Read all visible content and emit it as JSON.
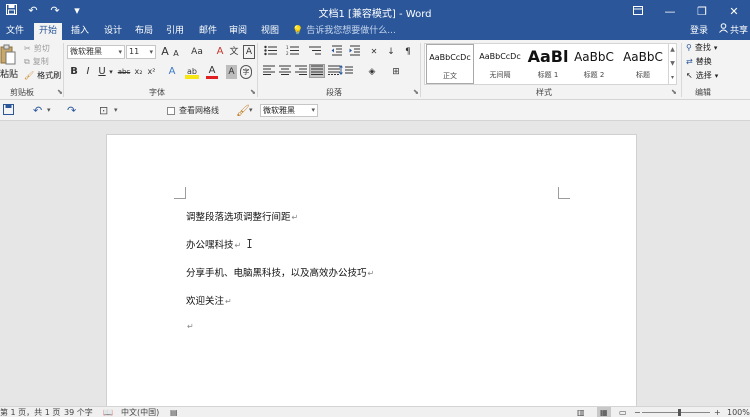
{
  "titlebar": {
    "title": "文档1 [兼容模式] - Word",
    "qat": {
      "save_icon": "save-icon",
      "undo_icon": "undo-icon",
      "redo_icon": "redo-icon",
      "customize_icon": "customize-icon"
    },
    "controls": {
      "ribbon_display": "ribbon-display-icon",
      "minimize": "—",
      "restore": "❐",
      "close": "✕"
    },
    "bg": "#2b579a"
  },
  "tabs": [
    {
      "label": "文件"
    },
    {
      "label": "开始",
      "active": true
    },
    {
      "label": "插入"
    },
    {
      "label": "设计"
    },
    {
      "label": "布局"
    },
    {
      "label": "引用"
    },
    {
      "label": "邮件"
    },
    {
      "label": "审阅"
    },
    {
      "label": "视图"
    }
  ],
  "tellme": {
    "placeholder": "告诉我您想要做什么..."
  },
  "account": {
    "login": "登录",
    "share": "共享"
  },
  "ribbon": {
    "clipboard": {
      "paste": "粘贴",
      "cut": "剪切",
      "copy": "复制",
      "format_painter": "格式刷",
      "label": "剪贴板"
    },
    "font": {
      "name": "微软雅黑",
      "size": "11",
      "label": "字体",
      "grow": "A",
      "shrink": "A",
      "case": "Aa",
      "clear": "A",
      "phonetic": "文",
      "border": "A",
      "bold": "B",
      "italic": "I",
      "underline": "U",
      "strike": "abc",
      "sub": "x₂",
      "sup": "x²",
      "effects": "A",
      "highlight": "ab",
      "color": "A",
      "shading": "A",
      "enclose": "字"
    },
    "paragraph": {
      "label": "段落"
    },
    "styles": {
      "label": "样式",
      "items": [
        {
          "preview": "AaBbCcDc",
          "name": "正文"
        },
        {
          "preview": "AaBbCcDc",
          "name": "无间隔"
        },
        {
          "preview": "AaBl",
          "name": "标题 1"
        },
        {
          "preview": "AaBbC",
          "name": "标题 2"
        },
        {
          "preview": "AaBbC",
          "name": "标题"
        }
      ]
    },
    "editing": {
      "label": "编辑",
      "find": "查找",
      "replace": "替换",
      "select": "选择"
    }
  },
  "toolbar2": {
    "gridlines": "查看网格线",
    "font": "微软雅黑"
  },
  "document": {
    "paragraphs": [
      "调整段落选项调整行间距",
      "办公嘿科技",
      "分享手机、电脑黑科技，以及高效办公技巧",
      "欢迎关注",
      ""
    ],
    "para_mark": "↵"
  },
  "status": {
    "page": "第 1 页，共 1 页",
    "words": "39 个字",
    "language": "中文(中国)",
    "zoom": "100%"
  }
}
